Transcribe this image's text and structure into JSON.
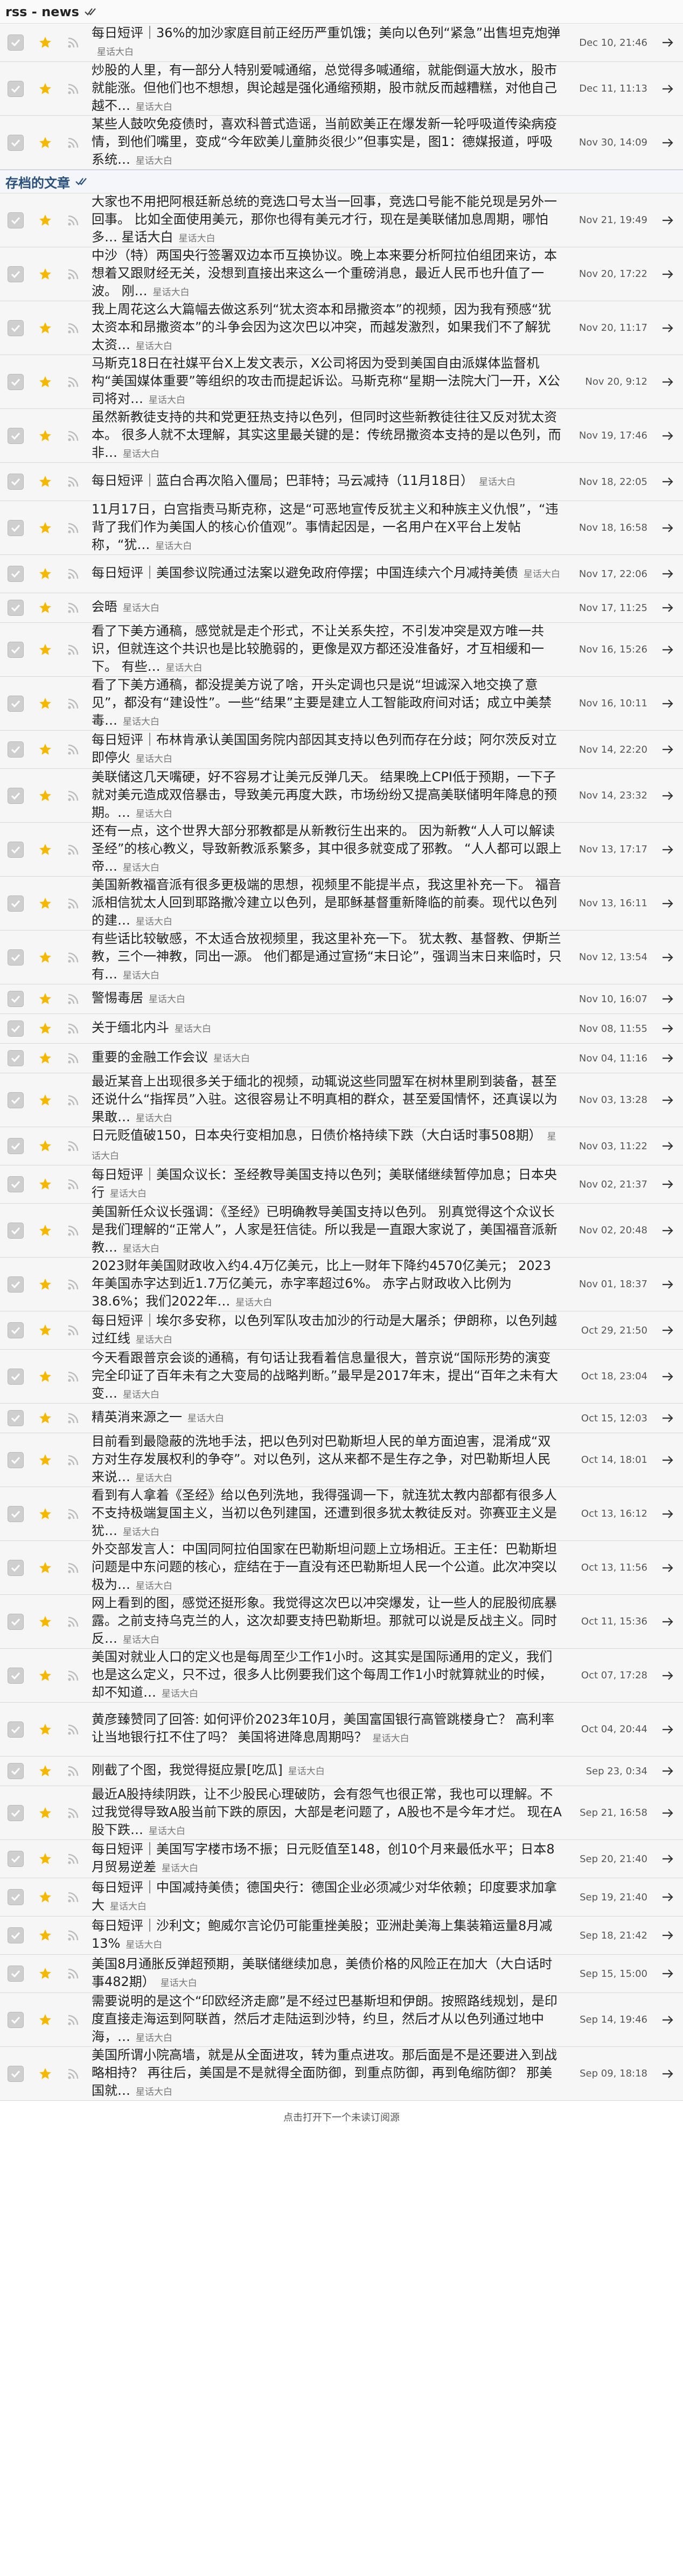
{
  "colors": {
    "star": "#f5b800",
    "rss": "#bcbcbc",
    "check_bg": "#cfcfcf",
    "arrow": "#333333"
  },
  "feed_section": {
    "title": "rss - news",
    "check_icon": "double-check-icon",
    "rows": [
      {
        "title": "每日短评｜36%的加沙家庭目前正经历严重饥饿；美向以色列“紧急”出售坦克炮弹",
        "author": "星话大白",
        "date": "Dec 10, 21:46",
        "lines": 2
      },
      {
        "title": "炒股的人里，有一部分人特别爱喊通缩，总觉得多喊通缩，就能倒逼大放水，股市就能涨。但他们也不想想，舆论越是强化通缩预期，股市就反而越糟糕，对他自己越不…",
        "author": "星话大白",
        "date": "Dec 11, 11:13",
        "lines": 3
      },
      {
        "title": "某些人鼓吹免疫债时，喜欢科普式造谣，当前欧美正在爆发新一轮呼吸道传染病疫情，到他们嘴里，变成“今年欧美儿童肺炎很少”但事实是，图1：德媒报道，呼吸系统…",
        "author": "星话大白",
        "date": "Nov 30, 14:09",
        "lines": 3
      }
    ]
  },
  "archive_section": {
    "title": "存档的文章",
    "check_icon": "double-check-icon",
    "rows": [
      {
        "title": "大家也不用把阿根廷新总统的竞选口号太当一回事，竞选口号能不能兑现是另外一回事。 比如全面使用美元，那你也得有美元才行，现在是美联储加息周期，哪怕多… 星话大白",
        "author": "星话大白",
        "date": "Nov 21, 19:49",
        "lines": 3
      },
      {
        "title": "中沙（特）两国央行签署双边本币互换协议。晚上本来要分析阿拉伯组团来访，本想着又跟财经无关，没想到直接出来这么一个重磅消息，最近人民币也升值了一波。 刚…",
        "author": "星话大白",
        "date": "Nov 20, 17:22",
        "lines": 3
      },
      {
        "title": "我上周花这么大篇幅去做这系列“犹太资本和昂撒资本”的视频，因为我有预感“犹太资本和昂撒资本”的斗争会因为这次巴以冲突，而越发激烈，如果我们不了解犹太资…",
        "author": "星话大白",
        "date": "Nov 20, 11:17",
        "lines": 3
      },
      {
        "title": "马斯克18日在社媒平台X上发文表示，X公司将因为受到美国自由派媒体监督机构“美国媒体重要”等组织的攻击而提起诉讼。马斯克称“星期一法院大门一开，X公司将对…",
        "author": "星话大白",
        "date": "Nov 20, 9:12",
        "lines": 3
      },
      {
        "title": "虽然新教徒支持的共和党更狂热支持以色列，但同时这些新教徒往往又反对犹太资本。 很多人就不太理解，其实这里最关键的是：传统昂撒资本支持的是以色列，而非…",
        "author": "星话大白",
        "date": "Nov 19, 17:46",
        "lines": 3
      },
      {
        "title": "每日短评｜蓝白合再次陷入僵局；巴菲特；马云减持（11月18日）",
        "author": "星话大白",
        "date": "Nov 18, 22:05",
        "lines": 2
      },
      {
        "title": "11月17日，白宫指责马斯克称，这是“可恶地宣传反犹主义和种族主义仇恨”，“违背了我们作为美国人的核心价值观”。事情起因是，一名用户在X平台上发帖称，“犹…",
        "author": "星话大白",
        "date": "Nov 18, 16:58",
        "lines": 3
      },
      {
        "title": "每日短评｜美国参议院通过法案以避免政府停摆；中国连续六个月减持美债",
        "author": "星话大白",
        "date": "Nov 17, 22:06",
        "lines": 2
      },
      {
        "title": "会晤",
        "author": "星话大白",
        "date": "Nov 17, 11:25",
        "lines": 1
      },
      {
        "title": "看了下美方通稿，感觉就是走个形式，不让关系失控，不引发冲突是双方唯一共识，但就连这个共识也是比较脆弱的，更像是双方都还没准备好，才互相缓和一下。 有些…",
        "author": "星话大白",
        "date": "Nov 16, 15:26",
        "lines": 3
      },
      {
        "title": "看了下美方通稿，都没提美方说了啥，开头定调也只是说“坦诚深入地交换了意见”，都没有“建设性”。一些“结果”主要是建立人工智能政府间对话；成立中美禁毒…",
        "author": "星话大白",
        "date": "Nov 16, 10:11",
        "lines": 3
      },
      {
        "title": "每日短评｜布林肯承认美国国务院内部因其支持以色列而存在分歧；阿尔茨反对立即停火",
        "author": "星话大白",
        "date": "Nov 14, 22:20",
        "lines": 2
      },
      {
        "title": "美联储这几天嘴硬，好不容易才让美元反弹几天。 结果晚上CPI低于预期，一下子就对美元造成双倍暴击，导致美元再度大跌，市场纷纷又提高美联储明年降息的预期。…",
        "author": "星话大白",
        "date": "Nov 14, 23:32",
        "lines": 3
      },
      {
        "title": "还有一点，这个世界大部分邪教都是从新教衍生出来的。 因为新教“人人可以解读圣经”的核心教义，导致新教派系繁多，其中很多就变成了邪教。 “人人都可以跟上帝…",
        "author": "星话大白",
        "date": "Nov 13, 17:17",
        "lines": 3
      },
      {
        "title": "美国新教福音派有很多更极端的思想，视频里不能提半点，我这里补充一下。 福音派相信犹太人回到耶路撒冷建立以色列，是耶稣基督重新降临的前奏。现代以色列的建…",
        "author": "星话大白",
        "date": "Nov 13, 16:11",
        "lines": 3
      },
      {
        "title": "有些话比较敏感，不太适合放视频里，我这里补充一下。 犹太教、基督教、伊斯兰教，三个一神教，同出一源。 他们都是通过宣扬“末日论”，强调当末日来临时，只有…",
        "author": "星话大白",
        "date": "Nov 12, 13:54",
        "lines": 3
      },
      {
        "title": "警惕毒居",
        "author": "星话大白",
        "date": "Nov 10, 16:07",
        "lines": 1
      },
      {
        "title": "关于缅北内斗",
        "author": "星话大白",
        "date": "Nov 08, 11:55",
        "lines": 1
      },
      {
        "title": "重要的金融工作会议",
        "author": "星话大白",
        "date": "Nov 04, 11:16",
        "lines": 1
      },
      {
        "title": "最近某音上出现很多关于缅北的视频，动辄说这些同盟军在树林里刷到装备，甚至还说什么“指挥员”入驻。这很容易让不明真相的群众，甚至爱国情怀，还真误以为果敢…",
        "author": "星话大白",
        "date": "Nov 03, 13:28",
        "lines": 3
      },
      {
        "title": "日元贬值破150，日本央行变相加息，日债价格持续下跌（大白话时事508期）",
        "author": "星话大白",
        "date": "Nov 03, 11:22",
        "lines": 2
      },
      {
        "title": "每日短评｜美国众议长：圣经教导美国支持以色列；美联储继续暂停加息；日本央行",
        "author": "星话大白",
        "date": "Nov 02, 21:37",
        "lines": 2
      },
      {
        "title": "美国新任众议长强调：《圣经》已明确教导美国支持以色列。 别真觉得这个众议长是我们理解的“正常人”，人家是狂信徒。所以我是一直跟大家说了，美国福音派新教…",
        "author": "星话大白",
        "date": "Nov 02, 20:48",
        "lines": 3
      },
      {
        "title": "2023财年美国财政收入约4.4万亿美元，比上一财年下降约4570亿美元； 2023年美国赤字达到近1.7万亿美元，赤字率超过6%。 赤字占财政收入比例为38.6%；我们2022年…",
        "author": "星话大白",
        "date": "Nov 01, 18:37",
        "lines": 3
      },
      {
        "title": "每日短评｜埃尔多安称，以色列军队攻击加沙的行动是大屠杀；伊朗称，以色列越过红线",
        "author": "星话大白",
        "date": "Oct 29, 21:50",
        "lines": 2
      },
      {
        "title": "今天看跟普京会谈的通稿，有句话让我看着信息量很大，普京说“国际形势的演变完全印证了百年未有之大变局的战略判断。”最早是2017年末，提出“百年之未有大变…",
        "author": "星话大白",
        "date": "Oct 18, 23:04",
        "lines": 3
      },
      {
        "title": "精英消来源之一",
        "author": "星话大白",
        "date": "Oct 15, 12:03",
        "lines": 1
      },
      {
        "title": "目前看到最隐蔽的洗地手法，把以色列对巴勒斯坦人民的单方面迫害，混淆成“双方对生存发展权利的争夺”。对以色列，这从来都不是生存之争，对巴勒斯坦人民来说…",
        "author": "星话大白",
        "date": "Oct 14, 18:01",
        "lines": 3
      },
      {
        "title": "看到有人拿着《圣经》给以色列洗地，我得强调一下，就连犹太教内部都有很多人不支持极端复国主义，当初以色列建国，还遭到很多犹太教徒反对。弥赛亚主义是犹…",
        "author": "星话大白",
        "date": "Oct 13, 16:12",
        "lines": 3
      },
      {
        "title": "外交部发言人：中国同阿拉伯国家在巴勒斯坦问题上立场相近。王主任：巴勒斯坦问题是中东问题的核心，症结在于一直没有还巴勒斯坦人民一个公道。此次冲突以极为…",
        "author": "星话大白",
        "date": "Oct 13, 11:56",
        "lines": 3
      },
      {
        "title": "网上看到的图，感觉还挺形象。我觉得这次巴以冲突爆发，让一些人的屁股彻底暴露。之前支持乌克兰的人，这次却要支持巴勒斯坦。那就可以说是反战主义。同时反…",
        "author": "星话大白",
        "date": "Oct 11, 15:36",
        "lines": 3
      },
      {
        "title": "美国对就业人口的定义也是每周至少工作1小时。这其实是国际通用的定义，我们也是这么定义，只不过，很多人比例要我们这个每周工作1小时就算就业的时候，却不知道…",
        "author": "星话大白",
        "date": "Oct 07, 17:28",
        "lines": 3
      },
      {
        "title": "黄彦臻赞同了回答: 如何评价2023年10月，美国富国银行高管跳楼身亡？ 高利率让当地银行扛不住了吗？ 美国将进降息周期吗？",
        "author": "星话大白",
        "date": "Oct 04, 20:44",
        "lines": 3
      },
      {
        "title": "刚截了个图，我觉得挺应景[吃瓜]",
        "author": "星话大白",
        "date": "Sep 23, 0:34",
        "lines": 1
      },
      {
        "title": "最近A股持续阴跌，让不少股民心理破防，会有怨气也很正常，我也可以理解。不过我觉得导致A股当前下跌的原因，大部是老问题了，A股也不是今年才烂。 现在A股下跌…",
        "author": "星话大白",
        "date": "Sep 21, 16:58",
        "lines": 3
      },
      {
        "title": "每日短评｜美国写字楼市场不振；日元贬值至148，创10个月来最低水平；日本8月贸易逆差",
        "author": "星话大白",
        "date": "Sep 20, 21:40",
        "lines": 2
      },
      {
        "title": "每日短评｜中国减持美债；德国央行：德国企业必须减少对华依赖；印度要求加拿大",
        "author": "星话大白",
        "date": "Sep 19, 21:40",
        "lines": 2
      },
      {
        "title": "每日短评｜沙利文；鲍威尔言论仍可能重挫美股；亚洲赴美海上集装箱运量8月减13%",
        "author": "星话大白",
        "date": "Sep 18, 21:42",
        "lines": 2
      },
      {
        "title": "美国8月通胀反弹超预期，美联储继续加息，美债价格的风险正在加大（大白话时事482期）",
        "author": "星话大白",
        "date": "Sep 15, 15:00",
        "lines": 2
      },
      {
        "title": "需要说明的是这个“印欧经济走廊”是不经过巴基斯坦和伊朗。按照路线规划，是印度直接走海运到阿联酋，然后才走陆运到沙特，约旦，然后才从以色列通过地中海，…",
        "author": "星话大白",
        "date": "Sep 14, 19:46",
        "lines": 3
      },
      {
        "title": "美国所谓小院高墙，就是从全面进攻，转为重点进攻。那后面是不是还要进入到战略相持？ 再往后，美国是不是就得全面防御，到重点防御，再到龟缩防御？ 那美国就…",
        "author": "星话大白",
        "date": "Sep 09, 18:18",
        "lines": 3
      }
    ]
  },
  "footer": {
    "text": "点击打开下一个未读订阅源"
  }
}
